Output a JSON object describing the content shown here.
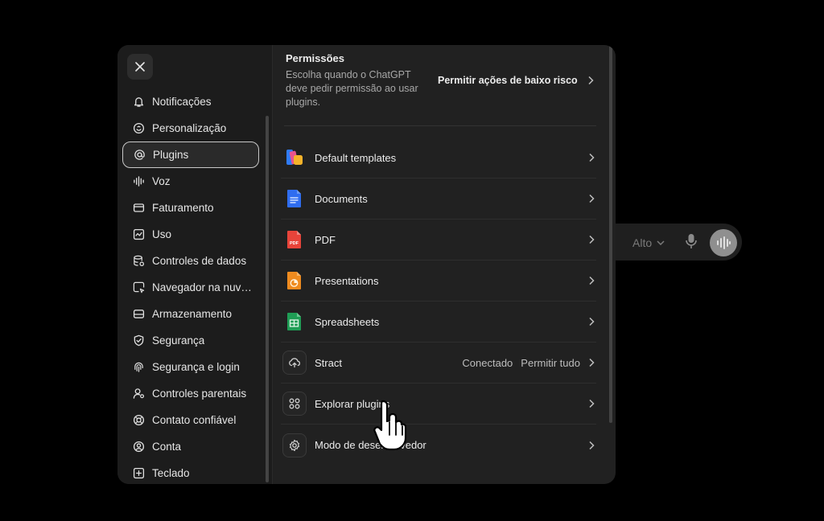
{
  "background": {
    "model_selector": "Alto"
  },
  "sidebar": {
    "items": [
      {
        "label": "Notificações",
        "icon": "bell-icon"
      },
      {
        "label": "Personalização",
        "icon": "personalization-icon"
      },
      {
        "label": "Plugins",
        "icon": "at-icon",
        "active": true
      },
      {
        "label": "Voz",
        "icon": "waveform-icon"
      },
      {
        "label": "Faturamento",
        "icon": "credit-card-icon"
      },
      {
        "label": "Uso",
        "icon": "chart-icon"
      },
      {
        "label": "Controles de dados",
        "icon": "database-icon"
      },
      {
        "label": "Navegador na nuve...",
        "icon": "cloud-browser-icon"
      },
      {
        "label": "Armazenamento",
        "icon": "storage-icon"
      },
      {
        "label": "Segurança",
        "icon": "shield-icon"
      },
      {
        "label": "Segurança e login",
        "icon": "fingerprint-icon"
      },
      {
        "label": "Controles parentais",
        "icon": "parental-icon"
      },
      {
        "label": "Contato confiável",
        "icon": "lifebuoy-icon"
      },
      {
        "label": "Conta",
        "icon": "account-icon"
      },
      {
        "label": "Teclado",
        "icon": "keyboard-icon"
      }
    ]
  },
  "permissions": {
    "title": "Permissões",
    "description": "Escolha quando o ChatGPT deve pedir permissão ao usar plugins.",
    "action": "Permitir ações de baixo risco"
  },
  "plugins": [
    {
      "label": "Default templates",
      "icon": "templates-icon"
    },
    {
      "label": "Documents",
      "icon": "documents-icon"
    },
    {
      "label": "PDF",
      "icon": "pdf-icon",
      "icon_text": "PDF"
    },
    {
      "label": "Presentations",
      "icon": "presentations-icon"
    },
    {
      "label": "Spreadsheets",
      "icon": "spreadsheets-icon"
    },
    {
      "label": "Stract",
      "icon": "stract-icon",
      "status": "Conectado",
      "permission": "Permitir tudo"
    },
    {
      "label": "Explorar plugins",
      "icon": "grid-icon"
    },
    {
      "label": "Modo de desenvolvedor",
      "icon": "gear-icon"
    }
  ]
}
